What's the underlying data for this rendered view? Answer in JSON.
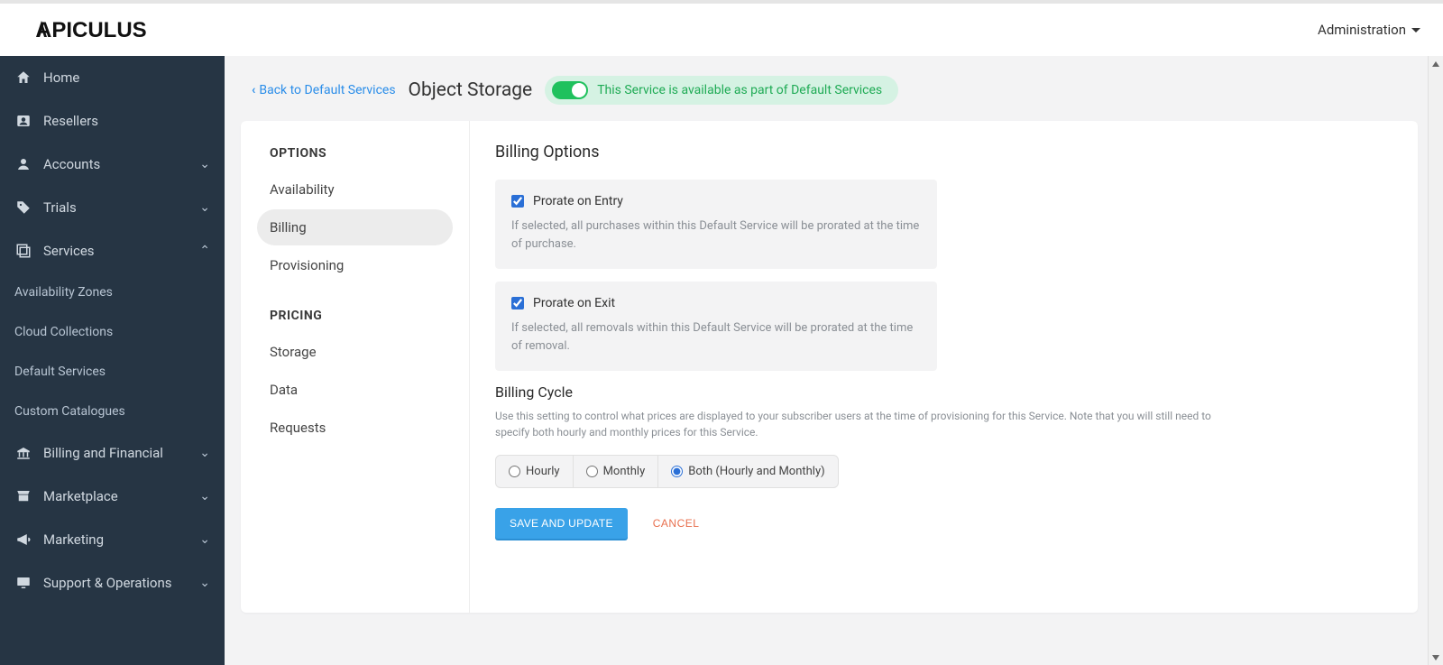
{
  "header": {
    "logo_text": "APICULUS",
    "admin_label": "Administration"
  },
  "sidebar": {
    "items": [
      {
        "label": "Home"
      },
      {
        "label": "Resellers"
      },
      {
        "label": "Accounts"
      },
      {
        "label": "Trials"
      },
      {
        "label": "Services"
      },
      {
        "label": "Billing and Financial"
      },
      {
        "label": "Marketplace"
      },
      {
        "label": "Marketing"
      },
      {
        "label": "Support & Operations"
      }
    ],
    "services_sub": [
      {
        "label": "Availability Zones"
      },
      {
        "label": "Cloud Collections"
      },
      {
        "label": "Default Services"
      },
      {
        "label": "Custom Catalogues"
      }
    ]
  },
  "page": {
    "back_label": "Back to Default Services",
    "title": "Object Storage",
    "status_text": "This Service is available as part of Default Services"
  },
  "options": {
    "header1": "OPTIONS",
    "items1": [
      {
        "label": "Availability"
      },
      {
        "label": "Billing"
      },
      {
        "label": "Provisioning"
      }
    ],
    "header2": "PRICING",
    "items2": [
      {
        "label": "Storage"
      },
      {
        "label": "Data"
      },
      {
        "label": "Requests"
      }
    ]
  },
  "billing": {
    "section_title": "Billing Options",
    "prorate_entry_label": "Prorate on Entry",
    "prorate_entry_desc": "If selected, all purchases within this Default Service will be prorated at the time of purchase.",
    "prorate_exit_label": "Prorate on Exit",
    "prorate_exit_desc": "If selected, all removals within this Default Service will be prorated at the time of removal.",
    "cycle_title": "Billing Cycle",
    "cycle_desc": "Use this setting to control what prices are displayed to your subscriber users at the time of provisioning for this Service. Note that you will still need to specify both hourly and monthly prices for this Service.",
    "radio_hourly": "Hourly",
    "radio_monthly": "Monthly",
    "radio_both": "Both (Hourly and Monthly)",
    "save_label": "SAVE AND UPDATE",
    "cancel_label": "CANCEL"
  }
}
